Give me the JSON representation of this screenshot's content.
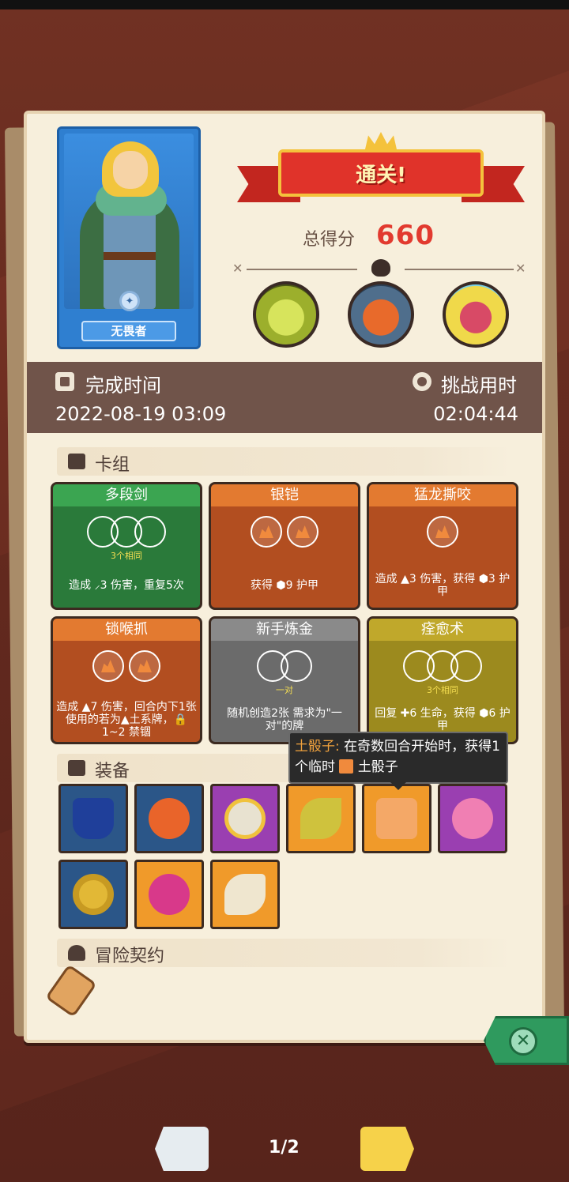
{
  "hero": {
    "name": "无畏者"
  },
  "result": {
    "banner": "通关!",
    "score_label": "总得分",
    "score": "660"
  },
  "times": {
    "complete_label": "完成时间",
    "complete_value": "2022-08-19 03:09",
    "challenge_label": "挑战用时",
    "challenge_value": "02:04:44"
  },
  "sections": {
    "deck": "卡组",
    "equipment": "装备",
    "contract": "冒险契约"
  },
  "cards": [
    {
      "title": "多段剑",
      "note": "3个相同",
      "desc": "造成 ⸝3 伤害，重复5次"
    },
    {
      "title": "银铠",
      "desc": "获得 ⬢9 护甲"
    },
    {
      "title": "猛龙撕咬",
      "desc": "造成 ▲3 伤害，获得 ⬢3 护甲"
    },
    {
      "title": "锁喉抓",
      "desc": "造成 ▲7 伤害，回合内下1张使用的若为▲土系牌，🔒1~2 禁锢"
    },
    {
      "title": "新手炼金",
      "note": "一对",
      "desc": "随机创造2张 需求为\"一对\"的牌"
    },
    {
      "title": "痊愈术",
      "note": "3个相同",
      "desc": "回复 ✚6 生命，获得 ⬢6 护甲"
    }
  ],
  "tooltip": {
    "name": "土骰子:",
    "text": "在奇数回合开始时，获得1个临时",
    "item": "土骰子"
  },
  "equipment_icons": [
    "top-hat-icon",
    "lightning-orb-icon",
    "mirror-icon",
    "feather-icon",
    "earth-dice-icon",
    "heart-amulet-icon",
    "ring-icon",
    "magic-orb-icon",
    "horn-icon"
  ],
  "pager": {
    "indicator": "1/2"
  },
  "colors": {
    "victory_red": "#e23a2f",
    "close_green": "#2f9a5e",
    "next_yellow": "#f6d24a"
  }
}
